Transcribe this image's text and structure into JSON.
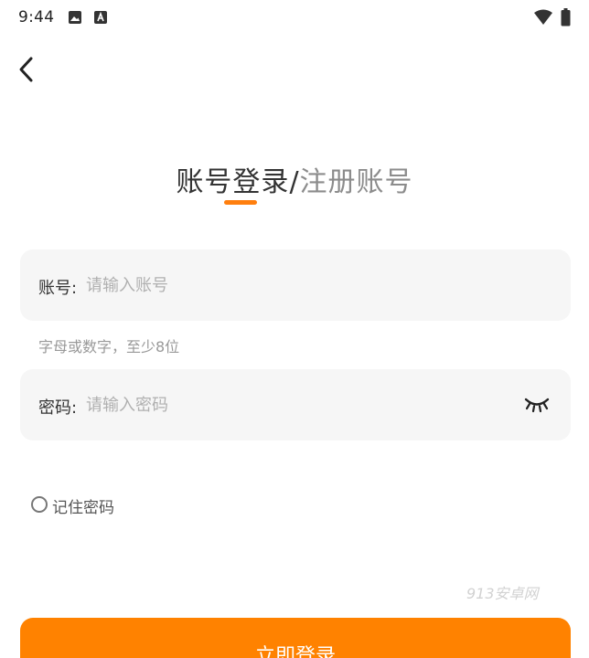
{
  "status_bar": {
    "time": "9:44",
    "icons": [
      "image-icon",
      "a-app-icon",
      "wifi-icon",
      "battery-icon"
    ]
  },
  "header": {
    "back_icon": "chevron-left-icon"
  },
  "tabs": {
    "login": "账号登录",
    "separator": "/",
    "register": "注册账号",
    "active": "login",
    "accent_color": "#ff7f0e"
  },
  "account": {
    "label": "账号:",
    "placeholder": "请输入账号",
    "value": "",
    "hint": "字母或数字，至少8位"
  },
  "password": {
    "label": "密码:",
    "placeholder": "请输入密码",
    "value": "",
    "toggle_icon": "eye-closed-icon"
  },
  "remember": {
    "label": "记住密码",
    "checked": false
  },
  "watermark": "913安卓网",
  "login_button": {
    "label": "立即登录",
    "color": "#ff8200"
  }
}
